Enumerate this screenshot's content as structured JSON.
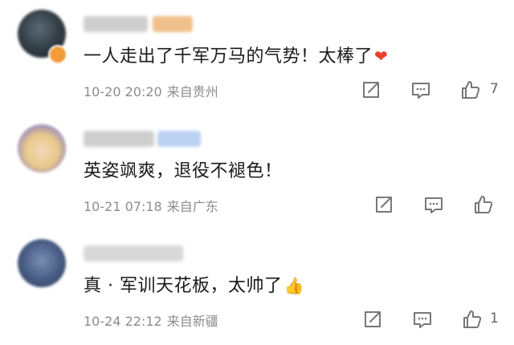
{
  "comments": [
    {
      "text": "一人走出了千军万马的气势！太棒了",
      "emoji": "❤",
      "time": "10-20 20:20",
      "location": "来自贵州",
      "likes": "7",
      "avatar_color": "#2f3a42",
      "emoji_color": "#e8402f"
    },
    {
      "text": "英姿飒爽，退役不褪色！",
      "emoji": "",
      "time": "10-21 07:18",
      "location": "来自广东",
      "likes": "",
      "avatar_color": "#e9c98a",
      "emoji_color": ""
    },
    {
      "text": "真 · 军训天花板，太帅了",
      "emoji": "👍",
      "time": "10-24 22:12",
      "location": "来自新疆",
      "likes": "1",
      "avatar_color": "#4a5f86",
      "emoji_color": "#e6b04a"
    }
  ],
  "icons": {
    "share": "share-icon",
    "comment": "comment-icon",
    "like": "thumbs-up-icon"
  }
}
